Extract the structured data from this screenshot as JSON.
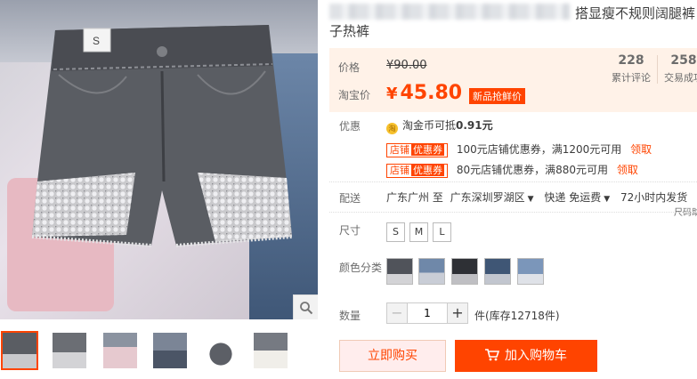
{
  "gallery": {
    "size_tag": "S",
    "zoom_icon": "magnifier-icon",
    "thumb_count": 6
  },
  "title": {
    "line1": "搭显瘦不规则阔腿裤",
    "line2": "子热裤"
  },
  "price": {
    "label": "价格",
    "original": "¥90.00",
    "taobao_label": "淘宝价",
    "yen": "¥",
    "now": "45.80",
    "promo_tag": "新品抢鲜价"
  },
  "stats": [
    {
      "num": "228",
      "label": "累计评论"
    },
    {
      "num": "258",
      "label": "交易成功"
    }
  ],
  "promo": {
    "label": "优惠",
    "coin_icon": "taobao-coin-icon",
    "coin_glyph": "淘",
    "coin_text_prefix": "淘金币可抵",
    "coin_amount": "0.91元",
    "coupons": [
      {
        "tag_left": "店铺",
        "tag_right": "优惠券",
        "text": "100元店铺优惠券，满1200元可用",
        "action": "领取"
      },
      {
        "tag_left": "店铺",
        "tag_right": "优惠券",
        "text": "80元店铺优惠券，满880元可用",
        "action": "领取"
      }
    ]
  },
  "shipping": {
    "label": "配送",
    "from": "广东广州 至",
    "to": "广东深圳罗湖区",
    "method": "快递 免运费",
    "time": "72小时内发货",
    "size_link": "尺码助"
  },
  "sizes": {
    "label": "尺寸",
    "options": [
      "S",
      "M",
      "L"
    ]
  },
  "colors": {
    "label": "颜色分类",
    "count": 5
  },
  "quantity": {
    "label": "数量",
    "minus": "−",
    "value": "1",
    "plus": "+",
    "unit": "件(库存12718件)"
  },
  "actions": {
    "buy_now": "立即购买",
    "cart_icon": "cart-icon",
    "add_cart": "加入购物车"
  },
  "colors_hex": {
    "accent": "#ff4400",
    "price_bg": "#fff2e8"
  }
}
